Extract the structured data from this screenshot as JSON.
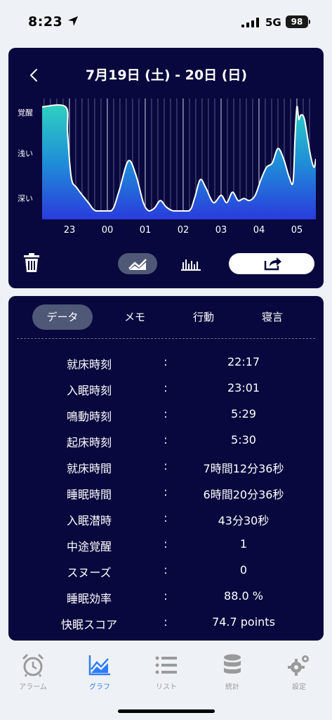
{
  "status_bar": {
    "time": "8:23",
    "network": "5G",
    "battery": "98"
  },
  "graph_card": {
    "title": "7月19日 (土) - 20日 (日)",
    "y_labels": [
      "覚醒",
      "浅い",
      "深い"
    ],
    "x_labels": [
      "23",
      "00",
      "01",
      "02",
      "03",
      "04",
      "05"
    ],
    "share_icon": "share-icon",
    "colors": {
      "card_bg": "#08083e",
      "area_top": "#29c8c0",
      "area_bottom": "#2a3bd8",
      "line": "#ffffff"
    }
  },
  "chart_data": {
    "type": "area",
    "x_label": "",
    "y_label": "",
    "y_levels": [
      "深い",
      "浅い",
      "覚醒"
    ],
    "ylim": [
      0,
      1
    ],
    "x_ticks": [
      "23",
      "00",
      "01",
      "02",
      "03",
      "04",
      "05"
    ],
    "xlim_hours": [
      22.28,
      29.5
    ],
    "series": [
      {
        "points": [
          [
            22.28,
            1.0
          ],
          [
            22.9,
            1.0
          ],
          [
            22.95,
            0.75
          ],
          [
            23.05,
            0.32
          ],
          [
            23.2,
            0.22
          ],
          [
            23.5,
            0.08
          ],
          [
            23.7,
            0.0
          ],
          [
            24.1,
            0.0
          ],
          [
            24.3,
            0.18
          ],
          [
            24.55,
            0.48
          ],
          [
            24.75,
            0.35
          ],
          [
            24.95,
            0.08
          ],
          [
            25.1,
            0.0
          ],
          [
            25.25,
            0.03
          ],
          [
            25.4,
            0.1
          ],
          [
            25.55,
            0.04
          ],
          [
            25.75,
            0.0
          ],
          [
            26.15,
            0.0
          ],
          [
            26.3,
            0.12
          ],
          [
            26.45,
            0.3
          ],
          [
            26.6,
            0.22
          ],
          [
            26.8,
            0.08
          ],
          [
            27.0,
            0.15
          ],
          [
            27.15,
            0.08
          ],
          [
            27.3,
            0.18
          ],
          [
            27.45,
            0.1
          ],
          [
            27.6,
            0.12
          ],
          [
            27.75,
            0.1
          ],
          [
            27.9,
            0.15
          ],
          [
            28.05,
            0.3
          ],
          [
            28.2,
            0.42
          ],
          [
            28.35,
            0.46
          ],
          [
            28.5,
            0.6
          ],
          [
            28.65,
            0.5
          ],
          [
            28.8,
            0.32
          ],
          [
            28.9,
            0.28
          ],
          [
            28.95,
            0.7
          ],
          [
            29.0,
            1.0
          ],
          [
            29.05,
            0.88
          ],
          [
            29.1,
            0.92
          ],
          [
            29.2,
            0.88
          ],
          [
            29.35,
            0.55
          ],
          [
            29.45,
            0.42
          ],
          [
            29.5,
            0.5
          ]
        ]
      }
    ]
  },
  "tabs": [
    "データ",
    "メモ",
    "行動",
    "寝言"
  ],
  "stats": [
    {
      "label": "就床時刻",
      "value": "22:17"
    },
    {
      "label": "入眠時刻",
      "value": "23:01"
    },
    {
      "label": "鳴動時刻",
      "value": "5:29"
    },
    {
      "label": "起床時刻",
      "value": "5:30"
    },
    {
      "label": "就床時間",
      "value": "7時間12分36秒"
    },
    {
      "label": "睡眠時間",
      "value": "6時間20分36秒"
    },
    {
      "label": "入眠潜時",
      "value": "43分30秒"
    },
    {
      "label": "中途覚醒",
      "value": "1"
    },
    {
      "label": "スヌーズ",
      "value": "0"
    },
    {
      "label": "睡眠効率",
      "value": "88.0 %"
    },
    {
      "label": "快眠スコア",
      "value": "74.7 points"
    }
  ],
  "separator": ":",
  "nav": [
    {
      "label": "アラーム",
      "icon": "alarm-clock-icon"
    },
    {
      "label": "グラフ",
      "icon": "graph-icon"
    },
    {
      "label": "リスト",
      "icon": "list-icon"
    },
    {
      "label": "統計",
      "icon": "database-icon"
    },
    {
      "label": "設定",
      "icon": "gears-icon"
    }
  ]
}
